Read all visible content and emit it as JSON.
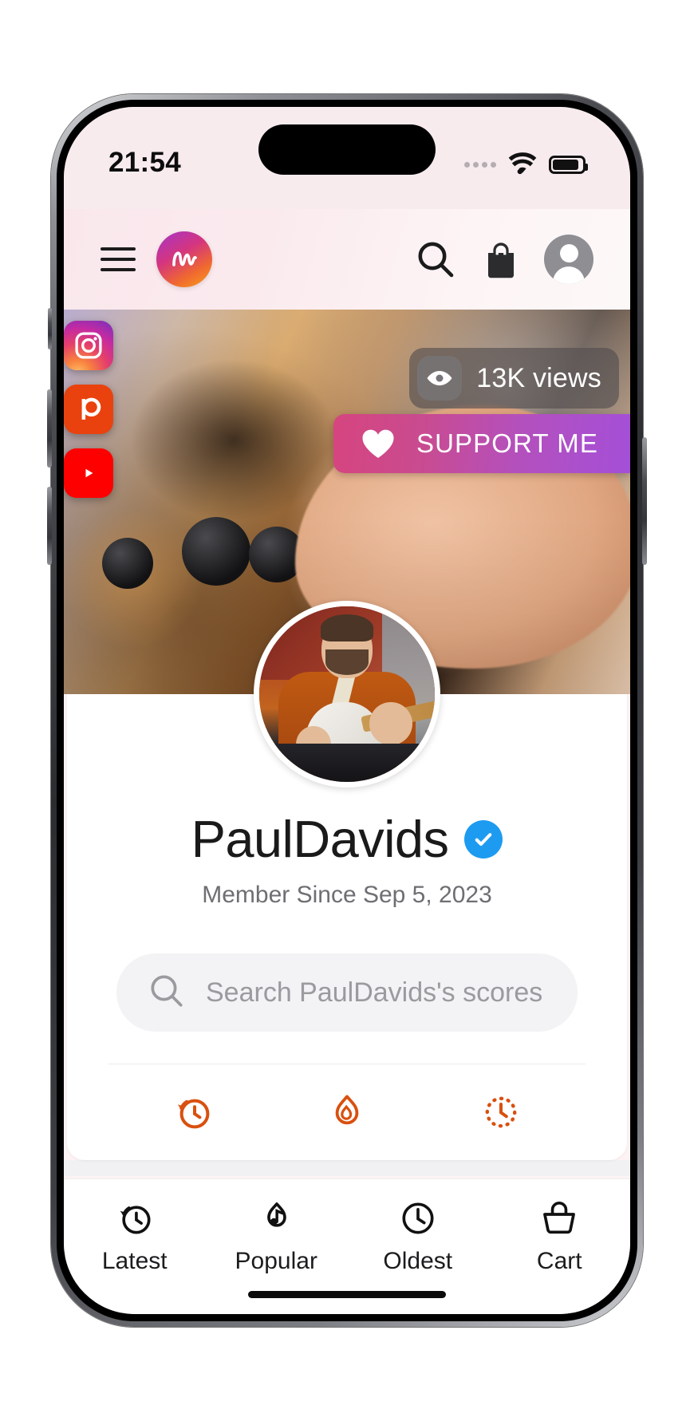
{
  "status_bar": {
    "time": "21:54",
    "signal_icon": "signal-dots-icon",
    "wifi_icon": "wifi-icon",
    "battery_icon": "battery-icon"
  },
  "app_header": {
    "menu_icon": "hamburger-menu-icon",
    "logo_icon": "waveform-logo-icon",
    "search_icon": "search-icon",
    "cart_icon": "shopping-bag-icon",
    "account_icon": "account-avatar-icon"
  },
  "cover": {
    "social_links": [
      {
        "name": "instagram",
        "icon": "instagram-icon",
        "color": "#c32aa3"
      },
      {
        "name": "patreon",
        "icon": "patreon-icon",
        "color": "#e9420e"
      },
      {
        "name": "youtube",
        "icon": "youtube-icon",
        "color": "#ff0000"
      }
    ],
    "views_badge": {
      "icon": "eye-icon",
      "text": "13K views"
    },
    "support_button": {
      "icon": "heart-icon",
      "label": "SUPPORT ME",
      "gradient_start": "#d6457f",
      "gradient_end": "#a44fd8"
    }
  },
  "profile": {
    "avatar_icon": "profile-photo",
    "name": "PaulDavids",
    "verified_icon": "verified-check-icon",
    "verified_color": "#1d9bf0",
    "member_since": "Member Since Sep 5, 2023"
  },
  "search": {
    "icon": "search-icon",
    "placeholder": "Search PaulDavids's scores"
  },
  "filters": {
    "accent_color": "#d9500f",
    "items": [
      {
        "name": "recent",
        "icon": "clock-rewind-icon"
      },
      {
        "name": "trending",
        "icon": "flame-icon"
      },
      {
        "name": "scheduled",
        "icon": "dotted-clock-icon"
      }
    ]
  },
  "tab_bar": {
    "items": [
      {
        "label": "Latest",
        "icon": "clock-rewind-icon"
      },
      {
        "label": "Popular",
        "icon": "music-note-fire-icon"
      },
      {
        "label": "Oldest",
        "icon": "clock-icon"
      },
      {
        "label": "Cart",
        "icon": "basket-icon"
      }
    ]
  }
}
